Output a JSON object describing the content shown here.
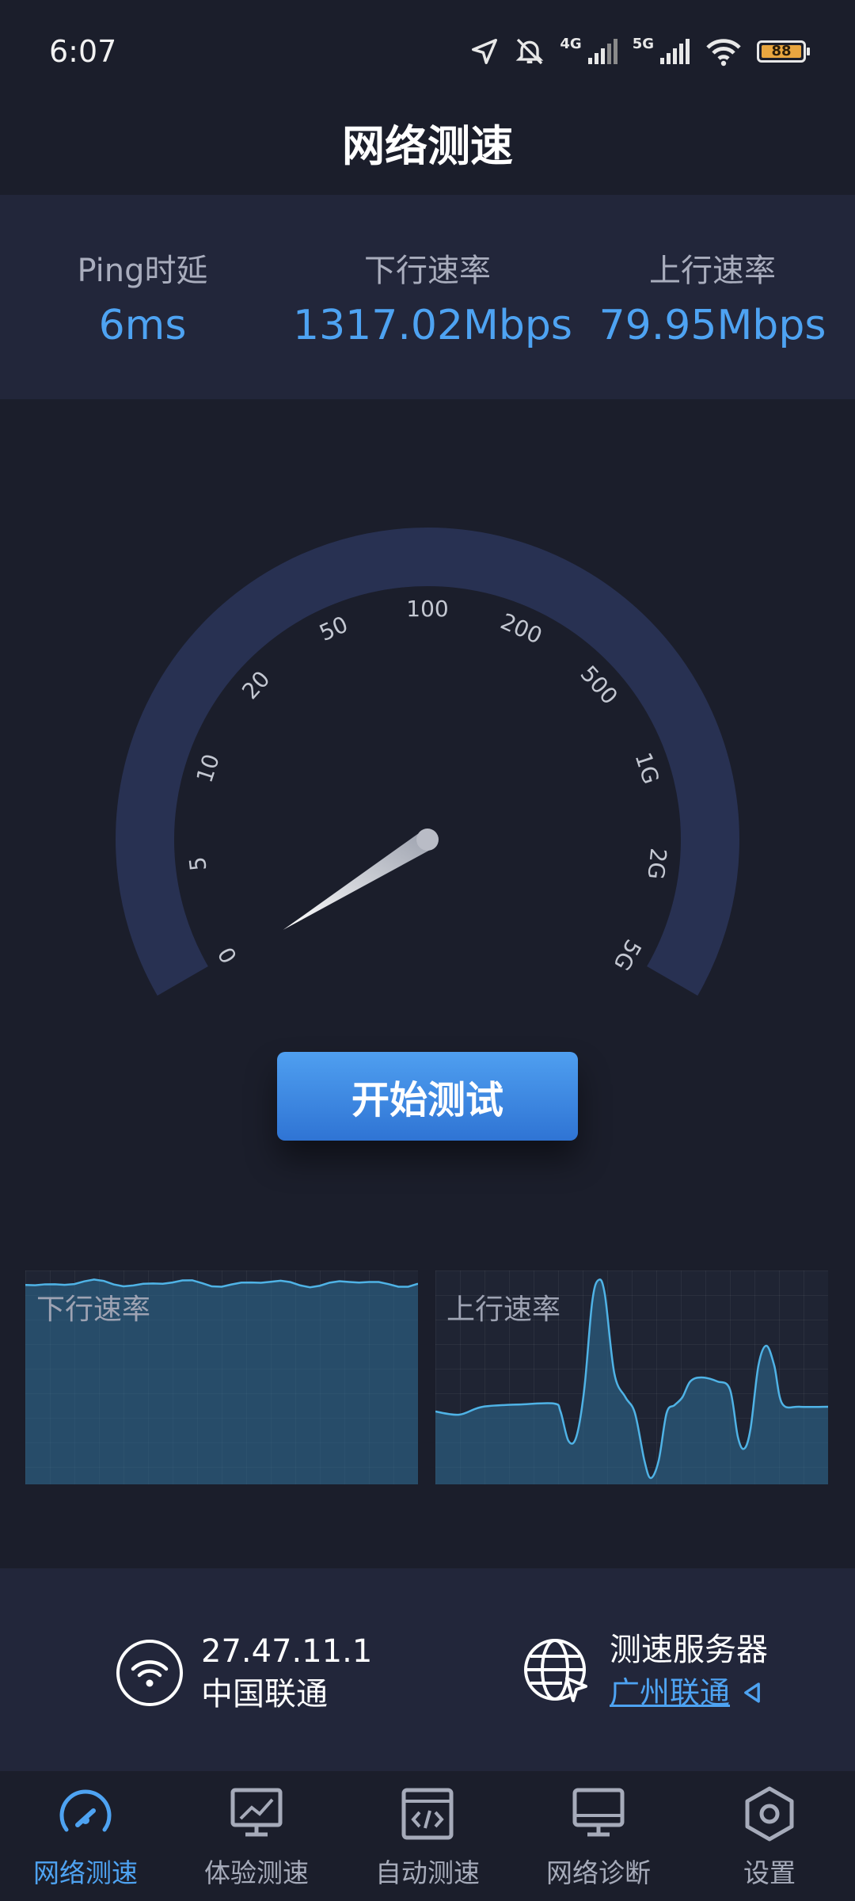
{
  "status_bar": {
    "time": "6:07",
    "net_label_1": "4G",
    "net_label_2": "5G",
    "battery": "88",
    "icons": [
      "location-icon",
      "mute-icon",
      "signal-4g-icon",
      "signal-5g-icon",
      "wifi-icon",
      "battery-icon"
    ]
  },
  "header": {
    "title": "网络测速"
  },
  "stats": {
    "ping_label": "Ping时延",
    "ping_value": "6ms",
    "download_label": "下行速率",
    "download_value": "1317.02Mbps",
    "upload_label": "上行速率",
    "upload_value": "79.95Mbps"
  },
  "gauge": {
    "ticks": [
      "0",
      "5",
      "10",
      "20",
      "50",
      "100",
      "200",
      "500",
      "1G",
      "2G",
      "5G"
    ],
    "needle_value": "0"
  },
  "start_button": {
    "label": "开始测试"
  },
  "charts": {
    "download_title": "下行速率",
    "upload_title": "上行速率",
    "download_level": 0.94,
    "upload_shape": "oscillating"
  },
  "info": {
    "ip": "27.47.11.1",
    "isp": "中国联通",
    "server_label": "测速服务器",
    "server_value": "广州联通"
  },
  "nav": {
    "items": [
      {
        "label": "网络测速",
        "icon": "speedometer-icon",
        "active": true
      },
      {
        "label": "体验测速",
        "icon": "monitor-chart-icon",
        "active": false
      },
      {
        "label": "自动测速",
        "icon": "code-window-icon",
        "active": false
      },
      {
        "label": "网络诊断",
        "icon": "desktop-icon",
        "active": false
      },
      {
        "label": "设置",
        "icon": "settings-hex-icon",
        "active": false
      }
    ]
  },
  "colors": {
    "accent": "#4ea3f2",
    "background": "#1b1e2b",
    "panel": "#22263a",
    "gauge_track": "#283152"
  }
}
